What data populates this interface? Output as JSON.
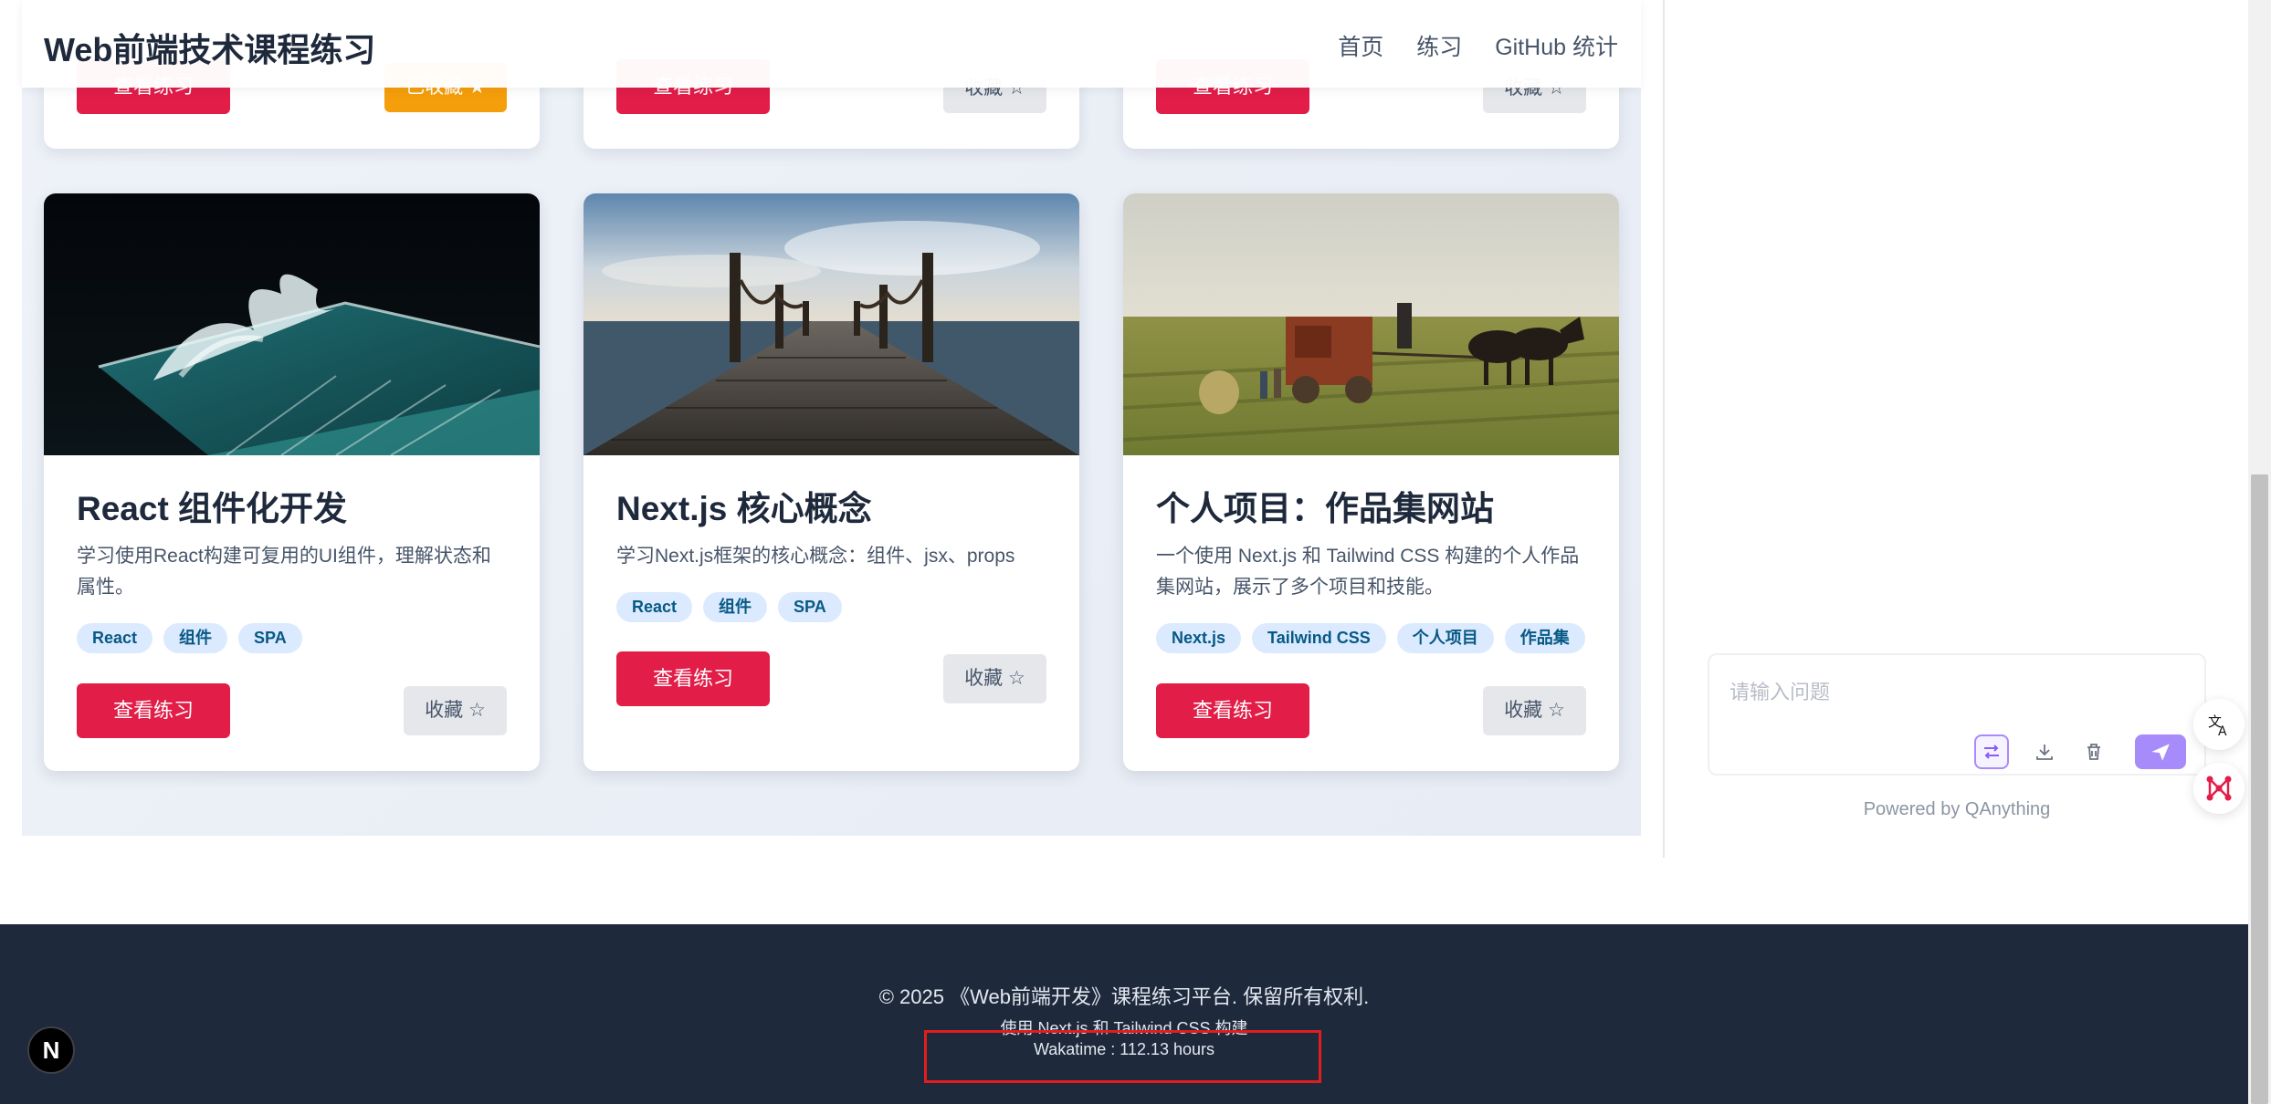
{
  "header": {
    "site_title": "Web前端技术课程练习",
    "nav": [
      "首页",
      "练习",
      "GitHub 统计"
    ]
  },
  "top_cards": [
    {
      "view_label": "查看练习",
      "fav_label": "已收藏 ★",
      "favorited": true
    },
    {
      "view_label": "查看练习",
      "fav_label": "收藏 ☆",
      "favorited": false
    },
    {
      "view_label": "查看练习",
      "fav_label": "收藏 ☆",
      "favorited": false
    }
  ],
  "cards": [
    {
      "image": "night-ocean-pool",
      "title": "React 组件化开发",
      "description": "学习使用React构建可复用的UI组件，理解状态和属性。",
      "tags": [
        "React",
        "组件",
        "SPA"
      ],
      "view_label": "查看练习",
      "fav_label": "收藏 ☆"
    },
    {
      "image": "wooden-pier-sea",
      "title": "Next.js 核心概念",
      "description": "学习Next.js框架的核心概念：组件、jsx、props",
      "tags": [
        "React",
        "组件",
        "SPA"
      ],
      "view_label": "查看练习",
      "fav_label": "收藏 ☆"
    },
    {
      "image": "farm-harvest-horses",
      "title": "个人项目：作品集网站",
      "description": "一个使用 Next.js 和 Tailwind CSS 构建的个人作品集网站，展示了多个项目和技能。",
      "tags": [
        "Next.js",
        "Tailwind CSS",
        "个人项目",
        "作品集"
      ],
      "view_label": "查看练习",
      "fav_label": "收藏 ☆"
    }
  ],
  "chat": {
    "placeholder": "请输入问题",
    "powered_by": "Powered by QAnything"
  },
  "footer": {
    "copyright": "© 2025 《Web前端开发》课程练习平台. 保留所有权利.",
    "built_with": "使用 Next.js 和 Tailwind CSS 构建",
    "wakatime": "Wakatime : 112.13 hours"
  },
  "badge": {
    "label": "N"
  },
  "colors": {
    "primary": "#e11d48",
    "favorite_active": "#f59e0b",
    "footer_bg": "#1e293b",
    "tag_bg": "#dbeafe",
    "highlight_box": "#e11d1d",
    "chat_send": "#a78bfa"
  }
}
